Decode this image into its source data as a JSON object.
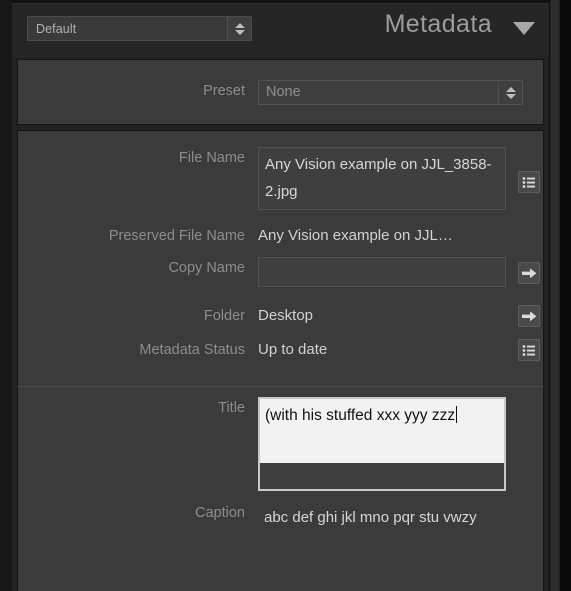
{
  "header": {
    "preset_selector": {
      "value": "Default",
      "icon": "stepper-updown-icon"
    },
    "title": "Metadata",
    "disclosure_icon": "triangle-down-icon"
  },
  "preset_section": {
    "label": "Preset",
    "value": "None",
    "stepper_icon": "stepper-updown-icon"
  },
  "fields": {
    "file_name": {
      "label": "File Name",
      "value": "Any Vision example  on JJL_3858-2.jpg",
      "action_icon": "list-icon"
    },
    "preserved_file_name": {
      "label": "Preserved File Name",
      "value": "Any Vision example  on JJL…"
    },
    "copy_name": {
      "label": "Copy Name",
      "value": "",
      "action_icon": "arrow-right-icon"
    },
    "folder": {
      "label": "Folder",
      "value": "Desktop",
      "action_icon": "arrow-right-icon"
    },
    "metadata_status": {
      "label": "Metadata Status",
      "value": "Up to date",
      "action_icon": "list-icon"
    },
    "title": {
      "label": "Title",
      "value": "(with his stuffed xxx yyy zzz",
      "focused": true
    },
    "caption": {
      "label": "Caption",
      "value": "abc def ghi jkl mno pqr stu vwzy"
    }
  },
  "colors": {
    "panel_bg": "#3b3b3b",
    "header_bg": "#262626",
    "label_text": "#8d8d8d",
    "value_text": "#d2d2d2",
    "active_field_bg": "#f2f2f2"
  }
}
